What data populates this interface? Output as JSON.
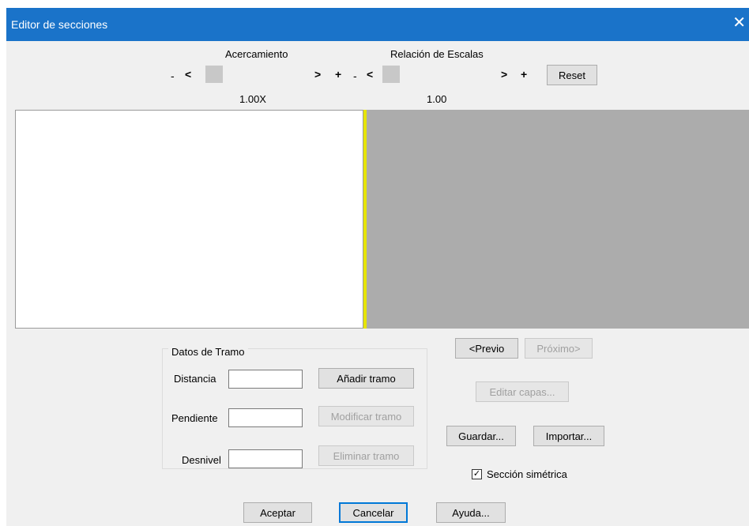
{
  "window": {
    "title": "Editor de secciones"
  },
  "icons": {
    "close": "close-icon"
  },
  "zoom": {
    "label": "Acercamiento",
    "minus": "-",
    "left": "<",
    "right": ">",
    "plus": "+",
    "value": "1.00X"
  },
  "scale": {
    "label": "Relación de Escalas",
    "minus": "-",
    "left": "<",
    "right": ">",
    "plus": "+",
    "value": "1.00",
    "reset_label": "Reset"
  },
  "nav": {
    "prev_label": "<Previo",
    "next_label": "Próximo>"
  },
  "buttons": {
    "edit_layers": "Editar capas...",
    "save": "Guardar...",
    "import": "Importar...",
    "accept": "Aceptar",
    "cancel": "Cancelar",
    "help": "Ayuda..."
  },
  "tramo": {
    "group_title": "Datos de Tramo",
    "distance_label": "Distancia",
    "slope_label": "Pendiente",
    "drop_label": "Desnivel",
    "distance_value": "",
    "slope_value": "",
    "drop_value": "",
    "add_label": "Añadir tramo",
    "modify_label": "Modificar tramo",
    "delete_label": "Eliminar tramo"
  },
  "symmetric": {
    "label": "Sección simétrica",
    "checked": true
  }
}
